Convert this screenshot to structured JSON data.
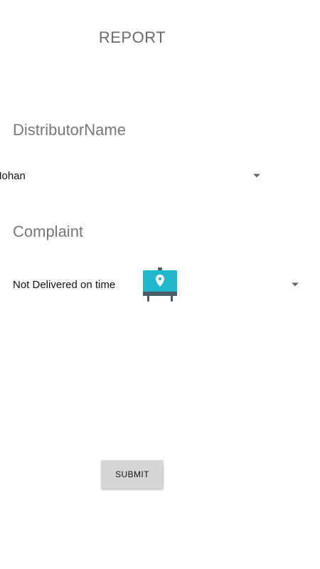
{
  "header": {
    "title": "REPORT"
  },
  "distributor": {
    "label": "DistributorName",
    "selected": "Mohan"
  },
  "complaint": {
    "label": "Complaint",
    "selected": "Not Delivered on time"
  },
  "actions": {
    "submit_label": "SUBMIT"
  },
  "icons": {
    "map_icon": "location-pin-easel-icon",
    "dropdown": "dropdown-arrow-icon"
  },
  "colors": {
    "icon_teal": "#20b7cf",
    "icon_dark": "#4a5c66",
    "button_bg": "#d6d6d6",
    "label_gray": "#777777"
  }
}
